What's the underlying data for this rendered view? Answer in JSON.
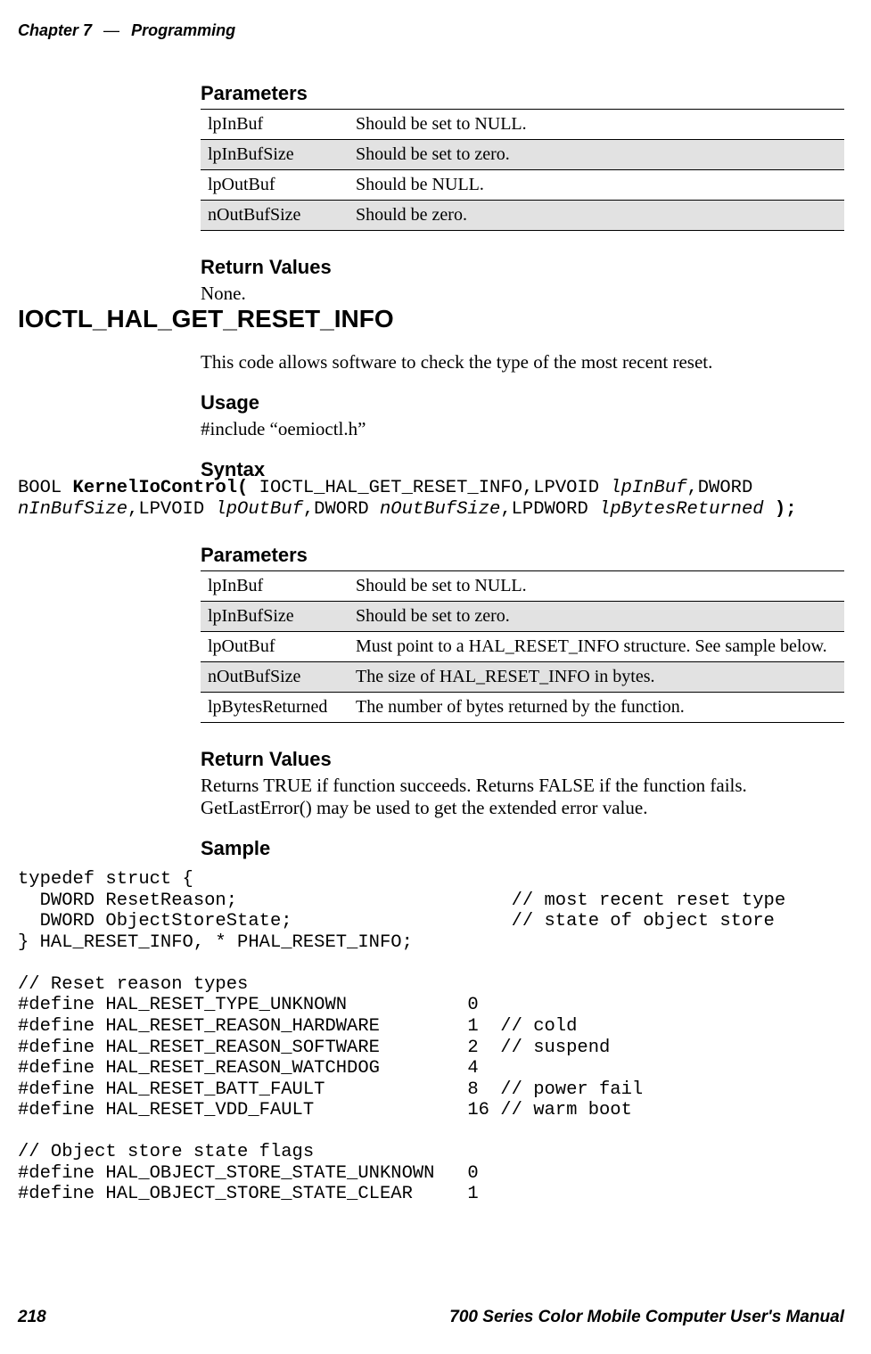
{
  "header": {
    "chapter": "Chapter 7",
    "sep": "—",
    "section": "Programming"
  },
  "footer": {
    "page": "218",
    "manual": "700 Series Color Mobile Computer User's Manual"
  },
  "sec1": {
    "h_params": "Parameters",
    "table": [
      {
        "k": "lpInBuf",
        "v": "Should be set to NULL."
      },
      {
        "k": "lpInBufSize",
        "v": "Should be set to zero."
      },
      {
        "k": "lpOutBuf",
        "v": "Should be NULL."
      },
      {
        "k": "nOutBufSize",
        "v": "Should be zero."
      }
    ],
    "h_ret": "Return Values",
    "ret_body": "None."
  },
  "main_heading": "IOCTL_HAL_GET_RESET_INFO",
  "sec2": {
    "intro": "This code allows software to check the type of the most recent reset.",
    "h_usage": "Usage",
    "usage_body": "#include “oemioctl.h”",
    "h_syntax": "Syntax",
    "syntax_code": "BOOL KernelIoControl( IOCTL_HAL_GET_RESET_INFO,LPVOID lpInBuf,DWORD\nnInBufSize,LPVOID lpOutBuf,DWORD nOutBufSize,LPDWORD lpBytesReturned );",
    "h_params": "Parameters",
    "table": [
      {
        "k": "lpInBuf",
        "v": "Should be set to NULL."
      },
      {
        "k": "lpInBufSize",
        "v": "Should be set to zero."
      },
      {
        "k": "lpOutBuf",
        "v": "Must point to a HAL_RESET_INFO structure. See sample below."
      },
      {
        "k": "nOutBufSize",
        "v": "The size of HAL_RESET_INFO in bytes."
      },
      {
        "k": "lpBytesReturned",
        "v": "The number of bytes returned by the function."
      }
    ],
    "h_ret": "Return Values",
    "ret_body": "Returns TRUE if function succeeds. Returns FALSE if the function fails. GetLastError() may be used to get the extended error value.",
    "h_sample": "Sample",
    "sample_code": "typedef struct {\n  DWORD ResetReason;                         // most recent reset type\n  DWORD ObjectStoreState;                    // state of object store\n} HAL_RESET_INFO, * PHAL_RESET_INFO;\n\n// Reset reason types\n#define HAL_RESET_TYPE_UNKNOWN           0\n#define HAL_RESET_REASON_HARDWARE        1  // cold\n#define HAL_RESET_REASON_SOFTWARE        2  // suspend\n#define HAL_RESET_REASON_WATCHDOG        4\n#define HAL_RESET_BATT_FAULT             8  // power fail\n#define HAL_RESET_VDD_FAULT              16 // warm boot\n\n// Object store state flags\n#define HAL_OBJECT_STORE_STATE_UNKNOWN   0\n#define HAL_OBJECT_STORE_STATE_CLEAR     1"
  }
}
